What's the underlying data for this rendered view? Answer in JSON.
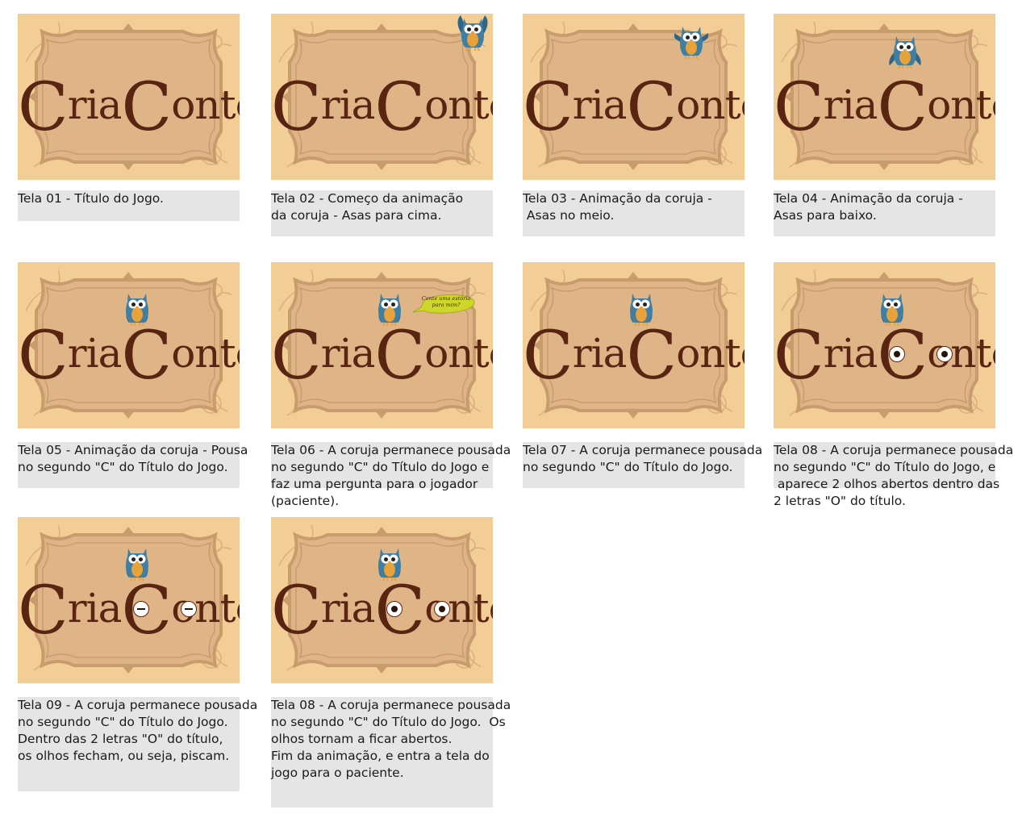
{
  "title_text": {
    "c1": "C",
    "ria": "ria",
    "c2": "C",
    "onto": "onto"
  },
  "bubble_text": "Conte uma estória para mim?",
  "screens": [
    {
      "caption": "Tela 01 - Título do Jogo."
    },
    {
      "caption": "Tela 02 - Começo da animação\nda coruja - Asas para cima."
    },
    {
      "caption": "Tela 03 - Animação da coruja -\n Asas no meio."
    },
    {
      "caption": "Tela 04 - Animação da coruja -\nAsas para baixo."
    },
    {
      "caption": "Tela 05 - Animação da coruja - Pousa\nno segundo \"C\" do Título do Jogo."
    },
    {
      "caption": "Tela 06 - A coruja permanece pousada\nno segundo \"C\" do Título do Jogo e\nfaz uma pergunta para o jogador\n(paciente)."
    },
    {
      "caption": "Tela 07 - A coruja permanece pousada\nno segundo \"C\" do Título do Jogo."
    },
    {
      "caption": "Tela 08 - A coruja permanece pousada\nno segundo \"C\" do Título do Jogo, e\n aparece 2 olhos abertos dentro das\n2 letras \"O\" do título."
    },
    {
      "caption": "Tela 09 - A coruja permanece pousada\nno segundo \"C\" do Título do Jogo.\nDentro das 2 letras \"O\" do título,\nos olhos fecham, ou seja, piscam."
    },
    {
      "caption": "Tela 08 - A coruja permanece pousada\nno segundo \"C\" do Título do Jogo.  Os\nolhos tornam a ficar abertos.\nFim da animação, e entra a tela do\njogo para o paciente."
    }
  ],
  "colors": {
    "frame_bg": "#f3cd96",
    "panel": "#dfb487",
    "ornament": "#c89c6c",
    "title": "#5a2412",
    "owl_body": "#3f7fa3",
    "caption_bg": "#e5e5e6",
    "bubble": "#cfd62a"
  }
}
